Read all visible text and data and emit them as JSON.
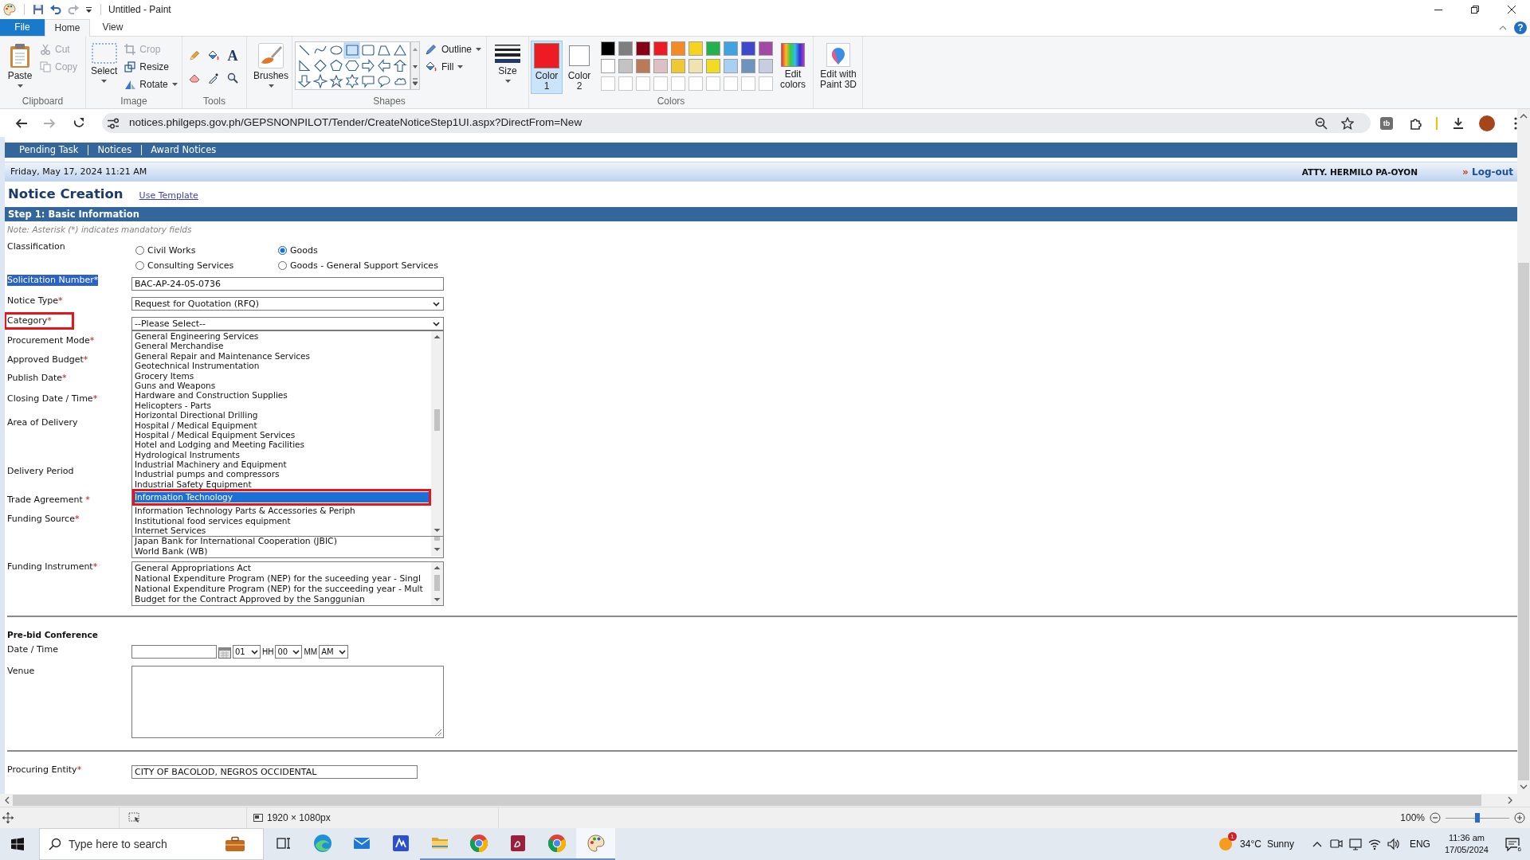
{
  "window": {
    "title": "Untitled - Paint",
    "help": "?"
  },
  "ribbon_tabs": [
    {
      "label": "File",
      "kind": "file",
      "selected": false
    },
    {
      "label": "Home",
      "kind": "tab",
      "selected": true
    },
    {
      "label": "View",
      "kind": "tab",
      "selected": false
    }
  ],
  "ribbon": {
    "clipboard": {
      "title": "Clipboard",
      "paste": "Paste",
      "actions": [
        {
          "label": "Cut",
          "kind": "cut",
          "disabled": true
        },
        {
          "label": "Copy",
          "kind": "copy",
          "disabled": true
        }
      ]
    },
    "image": {
      "title": "Image",
      "select": "Select",
      "actions": [
        {
          "label": "Crop",
          "kind": "crop",
          "disabled": true
        },
        {
          "label": "Resize",
          "kind": "resize",
          "disabled": false
        },
        {
          "label": "Rotate",
          "kind": "rotate",
          "disabled": false
        }
      ]
    },
    "tools": {
      "title": "Tools",
      "text_tool": "A"
    },
    "brushes": "Brushes",
    "shapes": {
      "title": "Shapes",
      "outline": "Outline",
      "fill": "Fill"
    },
    "size": "Size",
    "colors": {
      "title": "Colors",
      "slots": [
        {
          "label": "Color 1",
          "color": "#ed1c24",
          "selected": true
        },
        {
          "label": "Color 2",
          "color": "#ffffff",
          "selected": false
        }
      ],
      "palette": [
        {
          "kind": "color",
          "color": "#000000"
        },
        {
          "kind": "color",
          "color": "#7f7f7f"
        },
        {
          "kind": "color",
          "color": "#880015"
        },
        {
          "kind": "color",
          "color": "#ed1c24"
        },
        {
          "kind": "color",
          "color": "#f58a24"
        },
        {
          "kind": "color",
          "color": "#f5d31e"
        },
        {
          "kind": "color",
          "color": "#22b14c"
        },
        {
          "kind": "color",
          "color": "#3fa2e2"
        },
        {
          "kind": "color",
          "color": "#3f48cc"
        },
        {
          "kind": "color",
          "color": "#a349a4"
        },
        {
          "kind": "color",
          "color": "#ffffff"
        },
        {
          "kind": "color",
          "color": "#c3c3c3"
        },
        {
          "kind": "color",
          "color": "#b97a57"
        },
        {
          "kind": "color",
          "color": "#dcc0c4"
        },
        {
          "kind": "color",
          "color": "#f0c830"
        },
        {
          "kind": "color",
          "color": "#efe4b0"
        },
        {
          "kind": "color",
          "color": "#f2dc1e"
        },
        {
          "kind": "color",
          "color": "#a8d0f0"
        },
        {
          "kind": "color",
          "color": "#7092be"
        },
        {
          "kind": "color",
          "color": "#c8cde0"
        },
        {
          "kind": "empty"
        },
        {
          "kind": "empty"
        },
        {
          "kind": "empty"
        },
        {
          "kind": "empty"
        },
        {
          "kind": "empty"
        },
        {
          "kind": "empty"
        },
        {
          "kind": "empty"
        },
        {
          "kind": "empty"
        },
        {
          "kind": "empty"
        },
        {
          "kind": "empty"
        }
      ],
      "edit": "Edit colors"
    },
    "paint_3d": "Edit with Paint 3D"
  },
  "browser": {
    "buttons": [
      {
        "kind": "back",
        "disabled": false
      },
      {
        "kind": "forward",
        "disabled": true
      },
      {
        "kind": "reload",
        "disabled": false
      }
    ],
    "url": "notices.philgeps.gov.ph/GEPSNONPILOT/Tender/CreateNoticeStep1UI.aspx?DirectFrom=New",
    "extension_badge": "tb"
  },
  "page": {
    "nav_links": [
      "Pending Task",
      "Notices",
      "Award Notices"
    ],
    "date": "Friday, May 17, 2024 11:21 AM",
    "user": "ATTY. HERMILO PA-OYON",
    "logout": {
      "marker": "»",
      "label": "Log-out"
    },
    "heading": "Notice Creation",
    "template_link": "Use Template",
    "step_title": "Step 1: Basic Information",
    "note": "Note: Asterisk (*) indicates mandatory fields",
    "fields": [
      {
        "kind": "radios",
        "label": "Classification",
        "highlighted": false,
        "boxed": false,
        "options": [
          {
            "label": "Civil Works",
            "selected": false
          },
          {
            "label": "Goods",
            "selected": true
          },
          {
            "label": "Consulting Services",
            "selected": false
          },
          {
            "label": "Goods - General Support Services",
            "selected": false
          }
        ]
      },
      {
        "kind": "text",
        "label": "Solicitation Number",
        "mark": "*",
        "highlighted": true,
        "boxed": false,
        "value": "BAC-AP-24-05-0736"
      },
      {
        "kind": "select",
        "label": "Notice Type",
        "mark": "*",
        "highlighted": false,
        "boxed": false,
        "value": "Request for Quotation (RFQ)"
      },
      {
        "kind": "dropdown",
        "label": "Category",
        "mark": "*",
        "highlighted": false,
        "boxed": true,
        "value": "--Please Select--",
        "options": [
          {
            "label": "General Engineering Services",
            "selected": false,
            "boxed": false
          },
          {
            "label": "General Merchandise",
            "selected": false,
            "boxed": false
          },
          {
            "label": "General Repair and Maintenance Services",
            "selected": false,
            "boxed": false
          },
          {
            "label": "Geotechnical Instrumentation",
            "selected": false,
            "boxed": false
          },
          {
            "label": "Grocery Items",
            "selected": false,
            "boxed": false
          },
          {
            "label": "Guns and Weapons",
            "selected": false,
            "boxed": false
          },
          {
            "label": "Hardware and Construction Supplies",
            "selected": false,
            "boxed": false
          },
          {
            "label": "Helicopters - Parts",
            "selected": false,
            "boxed": false
          },
          {
            "label": "Horizontal Directional Drilling",
            "selected": false,
            "boxed": false
          },
          {
            "label": "Hospital / Medical Equipment",
            "selected": false,
            "boxed": false
          },
          {
            "label": "Hospital / Medical Equipment Services",
            "selected": false,
            "boxed": false
          },
          {
            "label": "Hotel and Lodging and Meeting Facilities",
            "selected": false,
            "boxed": false
          },
          {
            "label": "Hydrological Instruments",
            "selected": false,
            "boxed": false
          },
          {
            "label": "Industrial Machinery and Equipment",
            "selected": false,
            "boxed": false
          },
          {
            "label": "Industrial pumps and compressors",
            "selected": false,
            "boxed": false
          },
          {
            "label": "Industrial Safety Equipment",
            "selected": false,
            "boxed": false
          },
          {
            "label": "Information Technology",
            "selected": true,
            "boxed": true
          },
          {
            "label": "Information Technology Parts & Accessories & Periph",
            "selected": false,
            "boxed": false
          },
          {
            "label": "Institutional food services equipment",
            "selected": false,
            "boxed": false
          },
          {
            "label": "Internet Services",
            "selected": false,
            "boxed": false
          }
        ]
      },
      {
        "kind": "covered",
        "label": "Procurement Mode",
        "mark": "*",
        "highlighted": false,
        "boxed": false
      },
      {
        "kind": "covered",
        "label": "Approved Budget",
        "mark": "*",
        "highlighted": false,
        "boxed": false
      },
      {
        "kind": "covered",
        "label": "Publish Date",
        "mark": "*",
        "highlighted": false,
        "boxed": false
      },
      {
        "kind": "covered",
        "label": "Closing Date / Time",
        "mark": "*",
        "highlighted": false,
        "boxed": false
      },
      {
        "kind": "covered",
        "label": "Area of Delivery",
        "highlighted": false,
        "boxed": false
      },
      {
        "kind": "covered",
        "label": "Delivery Period",
        "highlighted": false,
        "boxed": false
      },
      {
        "kind": "covered",
        "label": "Trade Agreement",
        "mark": " *",
        "highlighted": false,
        "boxed": false
      },
      {
        "kind": "listbox-tail",
        "label": "Funding Source",
        "mark": "*",
        "highlighted": false,
        "boxed": false,
        "items": [
          "Japan Bank for International Cooperation (JBIC)",
          "World Bank (WB)"
        ]
      },
      {
        "kind": "listbox",
        "label": "Funding Instrument",
        "mark": "*",
        "highlighted": false,
        "boxed": false,
        "items": [
          "General Appropriations Act",
          "National Expenditure Program (NEP) for the suceeding year - Singl",
          "National Expenditure Program (NEP) for the succeeding year - Mult",
          "Budget for the Contract Approved by the Sanggunian"
        ]
      }
    ],
    "prebid": {
      "title": "Pre-bid Conference",
      "date_label": "Date / Time",
      "hour": "01",
      "hour_unit": "HH",
      "minute": "00",
      "minute_unit": "MM",
      "period": "AM",
      "venue_label": "Venue"
    },
    "procuring_entity": {
      "label": "Procuring Entity",
      "mark": "*",
      "value": "CITY OF BACOLOD, NEGROS OCCIDENTAL"
    }
  },
  "status_bar": {
    "image_size": "1920 × 1080px",
    "zoom": "100%",
    "zoom_slider": {
      "level": 0.5
    }
  },
  "taskbar": {
    "search_placeholder": "Type here to search",
    "apps": [
      {
        "kind": "task-view",
        "running": false,
        "selected": false
      },
      {
        "kind": "edge",
        "running": false,
        "selected": false
      },
      {
        "kind": "mail",
        "running": false,
        "selected": false
      },
      {
        "kind": "tile",
        "running": false,
        "selected": false
      },
      {
        "kind": "folder",
        "running": true,
        "selected": false
      },
      {
        "kind": "chrome",
        "running": true,
        "selected": false
      },
      {
        "kind": "pdf",
        "running": true,
        "selected": false
      },
      {
        "kind": "chrome",
        "running": true,
        "selected": false
      },
      {
        "kind": "paint",
        "running": true,
        "selected": true
      }
    ],
    "weather": {
      "badge": "1",
      "temperature": "34°C",
      "condition": "Sunny"
    },
    "language": "ENG",
    "time": "11:36 am",
    "date": "17/05/2024",
    "notifications": "6"
  }
}
